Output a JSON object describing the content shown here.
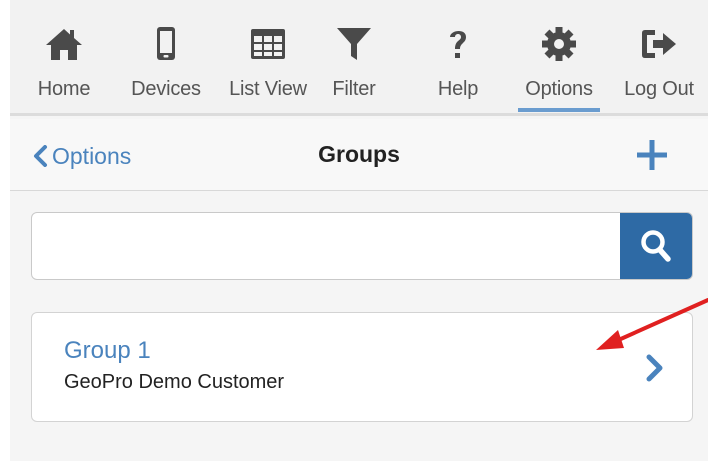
{
  "toolbar": {
    "items": [
      {
        "label": "Home",
        "icon": "home-icon"
      },
      {
        "label": "Devices",
        "icon": "mobile-device-icon"
      },
      {
        "label": "List View",
        "icon": "grid-table-icon"
      },
      {
        "label": "Filter",
        "icon": "funnel-filter-icon"
      },
      {
        "label": "Help",
        "icon": "question-mark-icon"
      },
      {
        "label": "Options",
        "icon": "gear-icon",
        "active": true
      },
      {
        "label": "Log Out",
        "icon": "sign-out-icon"
      }
    ]
  },
  "header": {
    "back_label": "Options",
    "title": "Groups",
    "add_icon": "plus-icon"
  },
  "search": {
    "value": "",
    "placeholder": "",
    "icon": "search-icon"
  },
  "groups": [
    {
      "name": "Group 1",
      "customer": "GeoPro Demo Customer"
    }
  ],
  "colors": {
    "accent": "#4a83bd",
    "search_button": "#2e6aa5",
    "active_underline": "#6a9ccf",
    "icon_gray": "#4a4a4a",
    "annotation_arrow": "#e02020"
  }
}
